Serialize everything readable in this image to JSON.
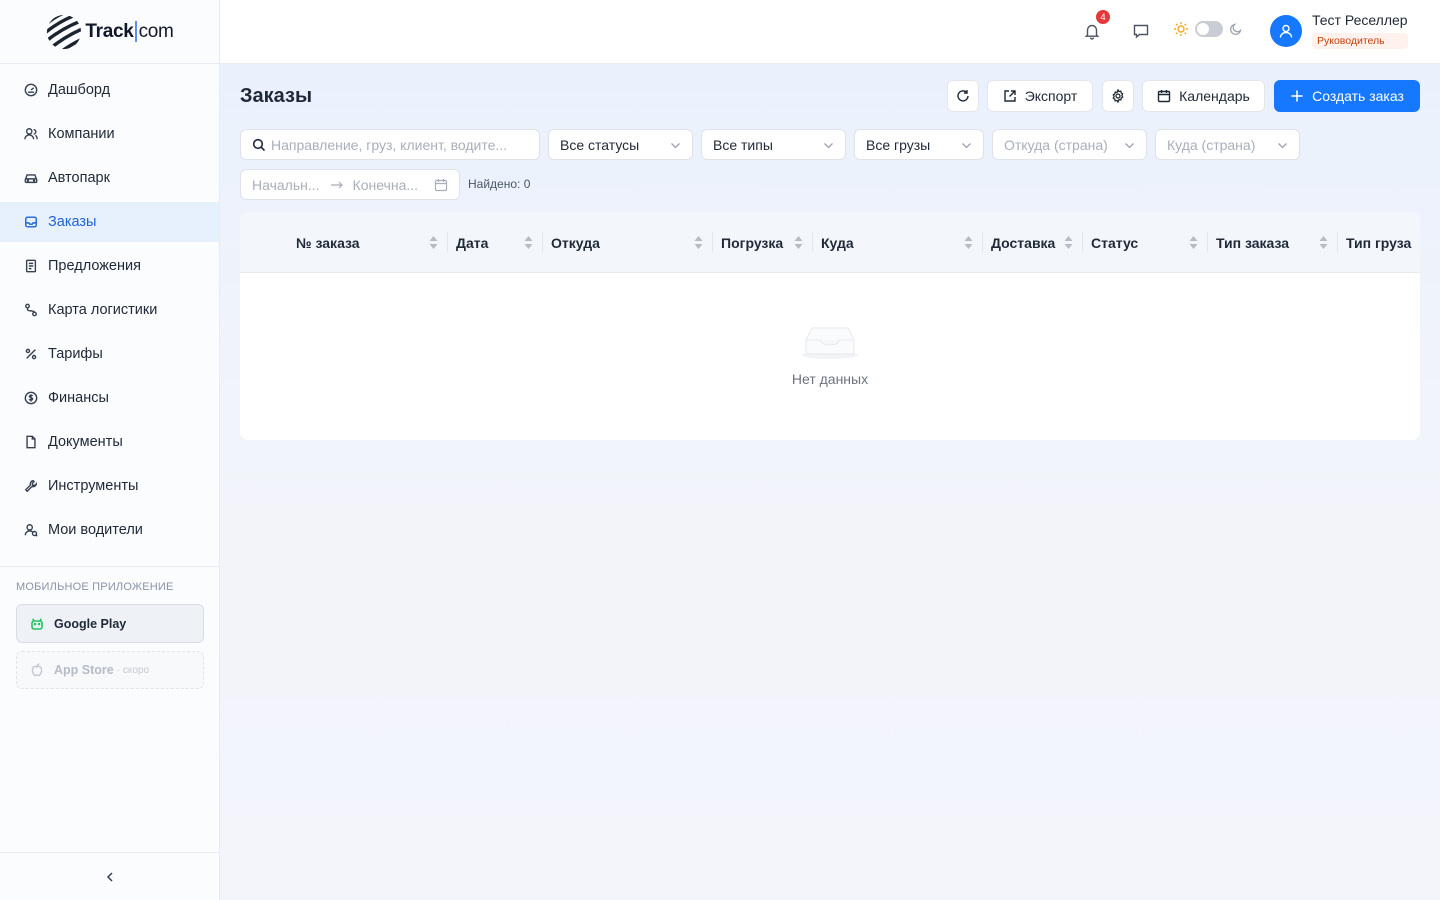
{
  "brand": {
    "name": "Track",
    "suffix": "com"
  },
  "sidebar": {
    "items": [
      {
        "label": "Дашборд",
        "icon": "dashboard-icon"
      },
      {
        "label": "Компании",
        "icon": "users-icon"
      },
      {
        "label": "Автопарк",
        "icon": "car-icon"
      },
      {
        "label": "Заказы",
        "icon": "inbox-icon",
        "active": true
      },
      {
        "label": "Предложения",
        "icon": "file-text-icon"
      },
      {
        "label": "Карта логистики",
        "icon": "route-icon"
      },
      {
        "label": "Тарифы",
        "icon": "percent-icon"
      },
      {
        "label": "Финансы",
        "icon": "dollar-icon"
      },
      {
        "label": "Документы",
        "icon": "document-icon"
      },
      {
        "label": "Инструменты",
        "icon": "wrench-icon"
      },
      {
        "label": "Мои водители",
        "icon": "driver-icon"
      }
    ],
    "mobile_title": "Мобильное приложение",
    "google_play": "Google Play",
    "app_store": "App Store",
    "app_store_soon": "· скоро"
  },
  "header": {
    "notifications_count": "4",
    "user_name": "Тест Реселлер",
    "user_role": "Руководитель"
  },
  "page": {
    "title": "Заказы",
    "toolbar": {
      "export": "Экспорт",
      "calendar": "Календарь",
      "create": "Создать заказ"
    },
    "filters": {
      "search_placeholder": "Направление, груз, клиент, водите...",
      "status": "Все статусы",
      "types": "Все типы",
      "cargo": "Все грузы",
      "from_country": "Откуда (страна)",
      "to_country": "Куда (страна)",
      "date_start": "Начальн...",
      "date_end": "Конечна..."
    },
    "found": "Найдено: 0",
    "table": {
      "columns": [
        "№ заказа",
        "Дата",
        "Откуда",
        "Погрузка",
        "Куда",
        "Доставка",
        "Статус",
        "Тип заказа",
        "Тип груза"
      ],
      "empty_text": "Нет данных"
    }
  },
  "colors": {
    "accent": "#1677ff",
    "active_bg": "#e7f0fd",
    "badge": "#e5383b"
  }
}
